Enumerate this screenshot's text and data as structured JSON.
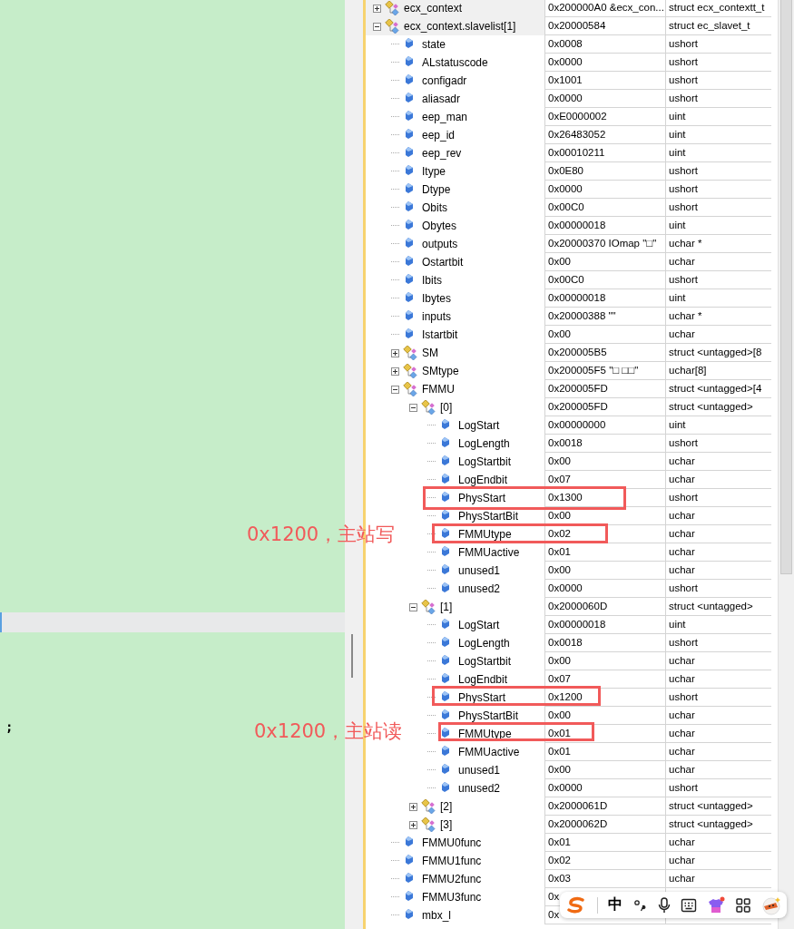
{
  "editor": {
    "lines": [
      ";"
    ]
  },
  "watch": {
    "rows": [
      {
        "name": "ecx_context",
        "value": "0x200000A0 &ecx_con...",
        "type": "struct ecx_contextt_t",
        "kind": "struct",
        "expanded": false
      },
      {
        "name": "ecx_context.slavelist[1]",
        "value": "0x20000584",
        "type": "struct ec_slavet_t",
        "kind": "struct",
        "expanded": true,
        "children": [
          {
            "name": "state",
            "value": "0x0008",
            "type": "ushort",
            "kind": "field"
          },
          {
            "name": "ALstatuscode",
            "value": "0x0000",
            "type": "ushort",
            "kind": "field"
          },
          {
            "name": "configadr",
            "value": "0x1001",
            "type": "ushort",
            "kind": "field"
          },
          {
            "name": "aliasadr",
            "value": "0x0000",
            "type": "ushort",
            "kind": "field"
          },
          {
            "name": "eep_man",
            "value": "0xE0000002",
            "type": "uint",
            "kind": "field"
          },
          {
            "name": "eep_id",
            "value": "0x26483052",
            "type": "uint",
            "kind": "field"
          },
          {
            "name": "eep_rev",
            "value": "0x00010211",
            "type": "uint",
            "kind": "field"
          },
          {
            "name": "Itype",
            "value": "0x0E80",
            "type": "ushort",
            "kind": "field"
          },
          {
            "name": "Dtype",
            "value": "0x0000",
            "type": "ushort",
            "kind": "field"
          },
          {
            "name": "Obits",
            "value": "0x00C0",
            "type": "ushort",
            "kind": "field"
          },
          {
            "name": "Obytes",
            "value": "0x00000018",
            "type": "uint",
            "kind": "field"
          },
          {
            "name": "outputs",
            "value": "0x20000370 IOmap \"□\"",
            "type": "uchar *",
            "kind": "field"
          },
          {
            "name": "Ostartbit",
            "value": "0x00",
            "type": "uchar",
            "kind": "field"
          },
          {
            "name": "Ibits",
            "value": "0x00C0",
            "type": "ushort",
            "kind": "field"
          },
          {
            "name": "Ibytes",
            "value": "0x00000018",
            "type": "uint",
            "kind": "field"
          },
          {
            "name": "inputs",
            "value": "0x20000388 \"\"",
            "type": "uchar *",
            "kind": "field"
          },
          {
            "name": "Istartbit",
            "value": "0x00",
            "type": "uchar",
            "kind": "field"
          },
          {
            "name": "SM",
            "value": "0x200005B5",
            "type": "struct <untagged>[8",
            "kind": "struct",
            "expanded": false
          },
          {
            "name": "SMtype",
            "value": "0x200005F5 \"□  □□\"",
            "type": "uchar[8]",
            "kind": "struct",
            "expanded": false
          },
          {
            "name": "FMMU",
            "value": "0x200005FD",
            "type": "struct <untagged>[4",
            "kind": "struct",
            "expanded": true,
            "children": [
              {
                "name": "[0]",
                "value": "0x200005FD",
                "type": "struct <untagged>",
                "kind": "struct",
                "expanded": true,
                "children": [
                  {
                    "name": "LogStart",
                    "value": "0x00000000",
                    "type": "uint",
                    "kind": "field"
                  },
                  {
                    "name": "LogLength",
                    "value": "0x0018",
                    "type": "ushort",
                    "kind": "field"
                  },
                  {
                    "name": "LogStartbit",
                    "value": "0x00",
                    "type": "uchar",
                    "kind": "field"
                  },
                  {
                    "name": "LogEndbit",
                    "value": "0x07",
                    "type": "uchar",
                    "kind": "field"
                  },
                  {
                    "name": "PhysStart",
                    "value": "0x1300",
                    "type": "ushort",
                    "kind": "field"
                  },
                  {
                    "name": "PhysStartBit",
                    "value": "0x00",
                    "type": "uchar",
                    "kind": "field"
                  },
                  {
                    "name": "FMMUtype",
                    "value": "0x02",
                    "type": "uchar",
                    "kind": "field"
                  },
                  {
                    "name": "FMMUactive",
                    "value": "0x01",
                    "type": "uchar",
                    "kind": "field"
                  },
                  {
                    "name": "unused1",
                    "value": "0x00",
                    "type": "uchar",
                    "kind": "field"
                  },
                  {
                    "name": "unused2",
                    "value": "0x0000",
                    "type": "ushort",
                    "kind": "field"
                  }
                ]
              },
              {
                "name": "[1]",
                "value": "0x2000060D",
                "type": "struct <untagged>",
                "kind": "struct",
                "expanded": true,
                "children": [
                  {
                    "name": "LogStart",
                    "value": "0x00000018",
                    "type": "uint",
                    "kind": "field"
                  },
                  {
                    "name": "LogLength",
                    "value": "0x0018",
                    "type": "ushort",
                    "kind": "field"
                  },
                  {
                    "name": "LogStartbit",
                    "value": "0x00",
                    "type": "uchar",
                    "kind": "field"
                  },
                  {
                    "name": "LogEndbit",
                    "value": "0x07",
                    "type": "uchar",
                    "kind": "field"
                  },
                  {
                    "name": "PhysStart",
                    "value": "0x1200",
                    "type": "ushort",
                    "kind": "field"
                  },
                  {
                    "name": "PhysStartBit",
                    "value": "0x00",
                    "type": "uchar",
                    "kind": "field"
                  },
                  {
                    "name": "FMMUtype",
                    "value": "0x01",
                    "type": "uchar",
                    "kind": "field"
                  },
                  {
                    "name": "FMMUactive",
                    "value": "0x01",
                    "type": "uchar",
                    "kind": "field"
                  },
                  {
                    "name": "unused1",
                    "value": "0x00",
                    "type": "uchar",
                    "kind": "field"
                  },
                  {
                    "name": "unused2",
                    "value": "0x0000",
                    "type": "ushort",
                    "kind": "field"
                  }
                ]
              },
              {
                "name": "[2]",
                "value": "0x2000061D",
                "type": "struct <untagged>",
                "kind": "struct",
                "expanded": false
              },
              {
                "name": "[3]",
                "value": "0x2000062D",
                "type": "struct <untagged>",
                "kind": "struct",
                "expanded": false
              }
            ]
          },
          {
            "name": "FMMU0func",
            "value": "0x01",
            "type": "uchar",
            "kind": "field"
          },
          {
            "name": "FMMU1func",
            "value": "0x02",
            "type": "uchar",
            "kind": "field"
          },
          {
            "name": "FMMU2func",
            "value": "0x03",
            "type": "uchar",
            "kind": "field"
          },
          {
            "name": "FMMU3func",
            "value": "0x",
            "kind": "field"
          },
          {
            "name": "mbx_l",
            "value": "0x",
            "kind": "field"
          }
        ]
      }
    ]
  },
  "annotations": [
    {
      "text": "0x1200，主站写"
    },
    {
      "text": "0x1200，主站读"
    }
  ],
  "ime_toolbar": {
    "mode": "中"
  }
}
